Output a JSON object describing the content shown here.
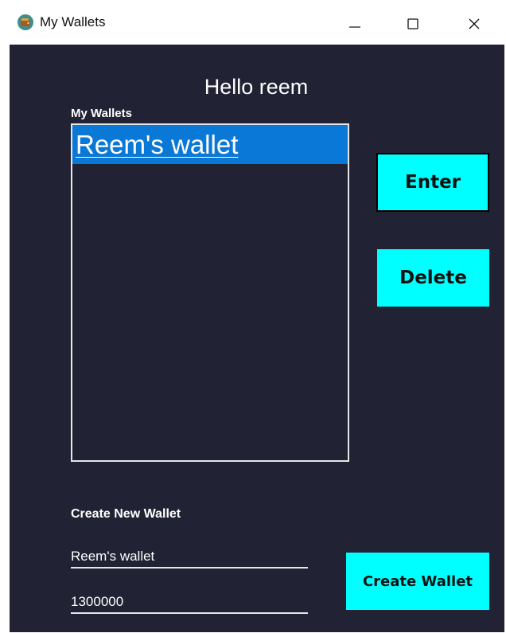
{
  "window": {
    "title": "My Wallets",
    "icon": "wallet-app-icon",
    "controls": {
      "minimize_icon": "minimize-icon",
      "maximize_icon": "maximize-icon",
      "close_icon": "close-icon"
    }
  },
  "greeting": "Hello reem",
  "wallets": {
    "label": "My Wallets",
    "items": [
      {
        "label": "Reem's wallet",
        "selected": true
      }
    ]
  },
  "actions": {
    "enter_label": "Enter",
    "delete_label": "Delete"
  },
  "create": {
    "section_label": "Create New Wallet",
    "name_value": "Reem's wallet",
    "amount_value": "1300000",
    "button_label": "Create Wallet"
  },
  "colors": {
    "background": "#212234",
    "accent_button": "#00ffff",
    "selection": "#0a78d7",
    "text": "#ffffff"
  }
}
